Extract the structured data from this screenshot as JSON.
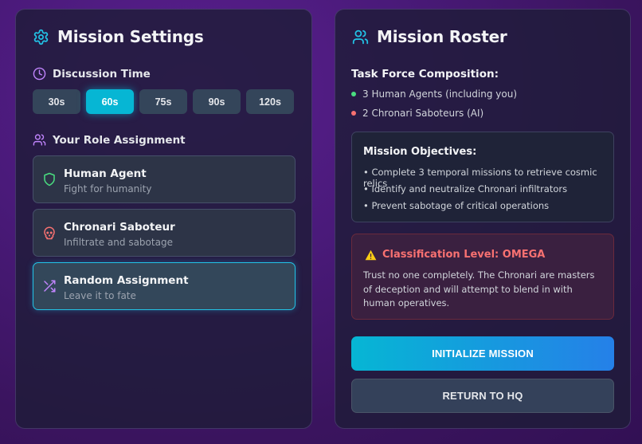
{
  "settings": {
    "title": "Mission Settings",
    "discussion_label": "Discussion Time",
    "times": [
      "30s",
      "60s",
      "75s",
      "90s",
      "120s"
    ],
    "selected_time": "60s",
    "role_label": "Your Role Assignment",
    "roles": [
      {
        "title": "Human Agent",
        "subtitle": "Fight for humanity",
        "icon": "shield-icon"
      },
      {
        "title": "Chronari Saboteur",
        "subtitle": "Infiltrate and sabotage",
        "icon": "skull-icon"
      },
      {
        "title": "Random Assignment",
        "subtitle": "Leave it to fate",
        "icon": "shuffle-icon"
      }
    ],
    "selected_role": "Random Assignment"
  },
  "roster": {
    "title": "Mission Roster",
    "composition_label": "Task Force Composition:",
    "composition": [
      {
        "text": "3 Human Agents (including you)",
        "color": "#4ade80"
      },
      {
        "text": "2 Chronari Saboteurs (AI)",
        "color": "#f87171"
      }
    ],
    "objectives_title": "Mission Objectives:",
    "objectives": [
      "• Complete 3 temporal missions to retrieve cosmic relics",
      "• Identify and neutralize Chronari infiltrators",
      "• Prevent sabotage of critical operations"
    ],
    "warning_title": "Classification Level: OMEGA",
    "warning_text": "Trust no one completely. The Chronari are masters of deception and will attempt to blend in with human operatives.",
    "primary_button": "INITIALIZE MISSION",
    "secondary_button": "RETURN TO HQ"
  },
  "colors": {
    "accent": "#06b6d4",
    "human": "#4ade80",
    "saboteur": "#f87171",
    "random": "#c084fc",
    "warning": "#facc15"
  }
}
